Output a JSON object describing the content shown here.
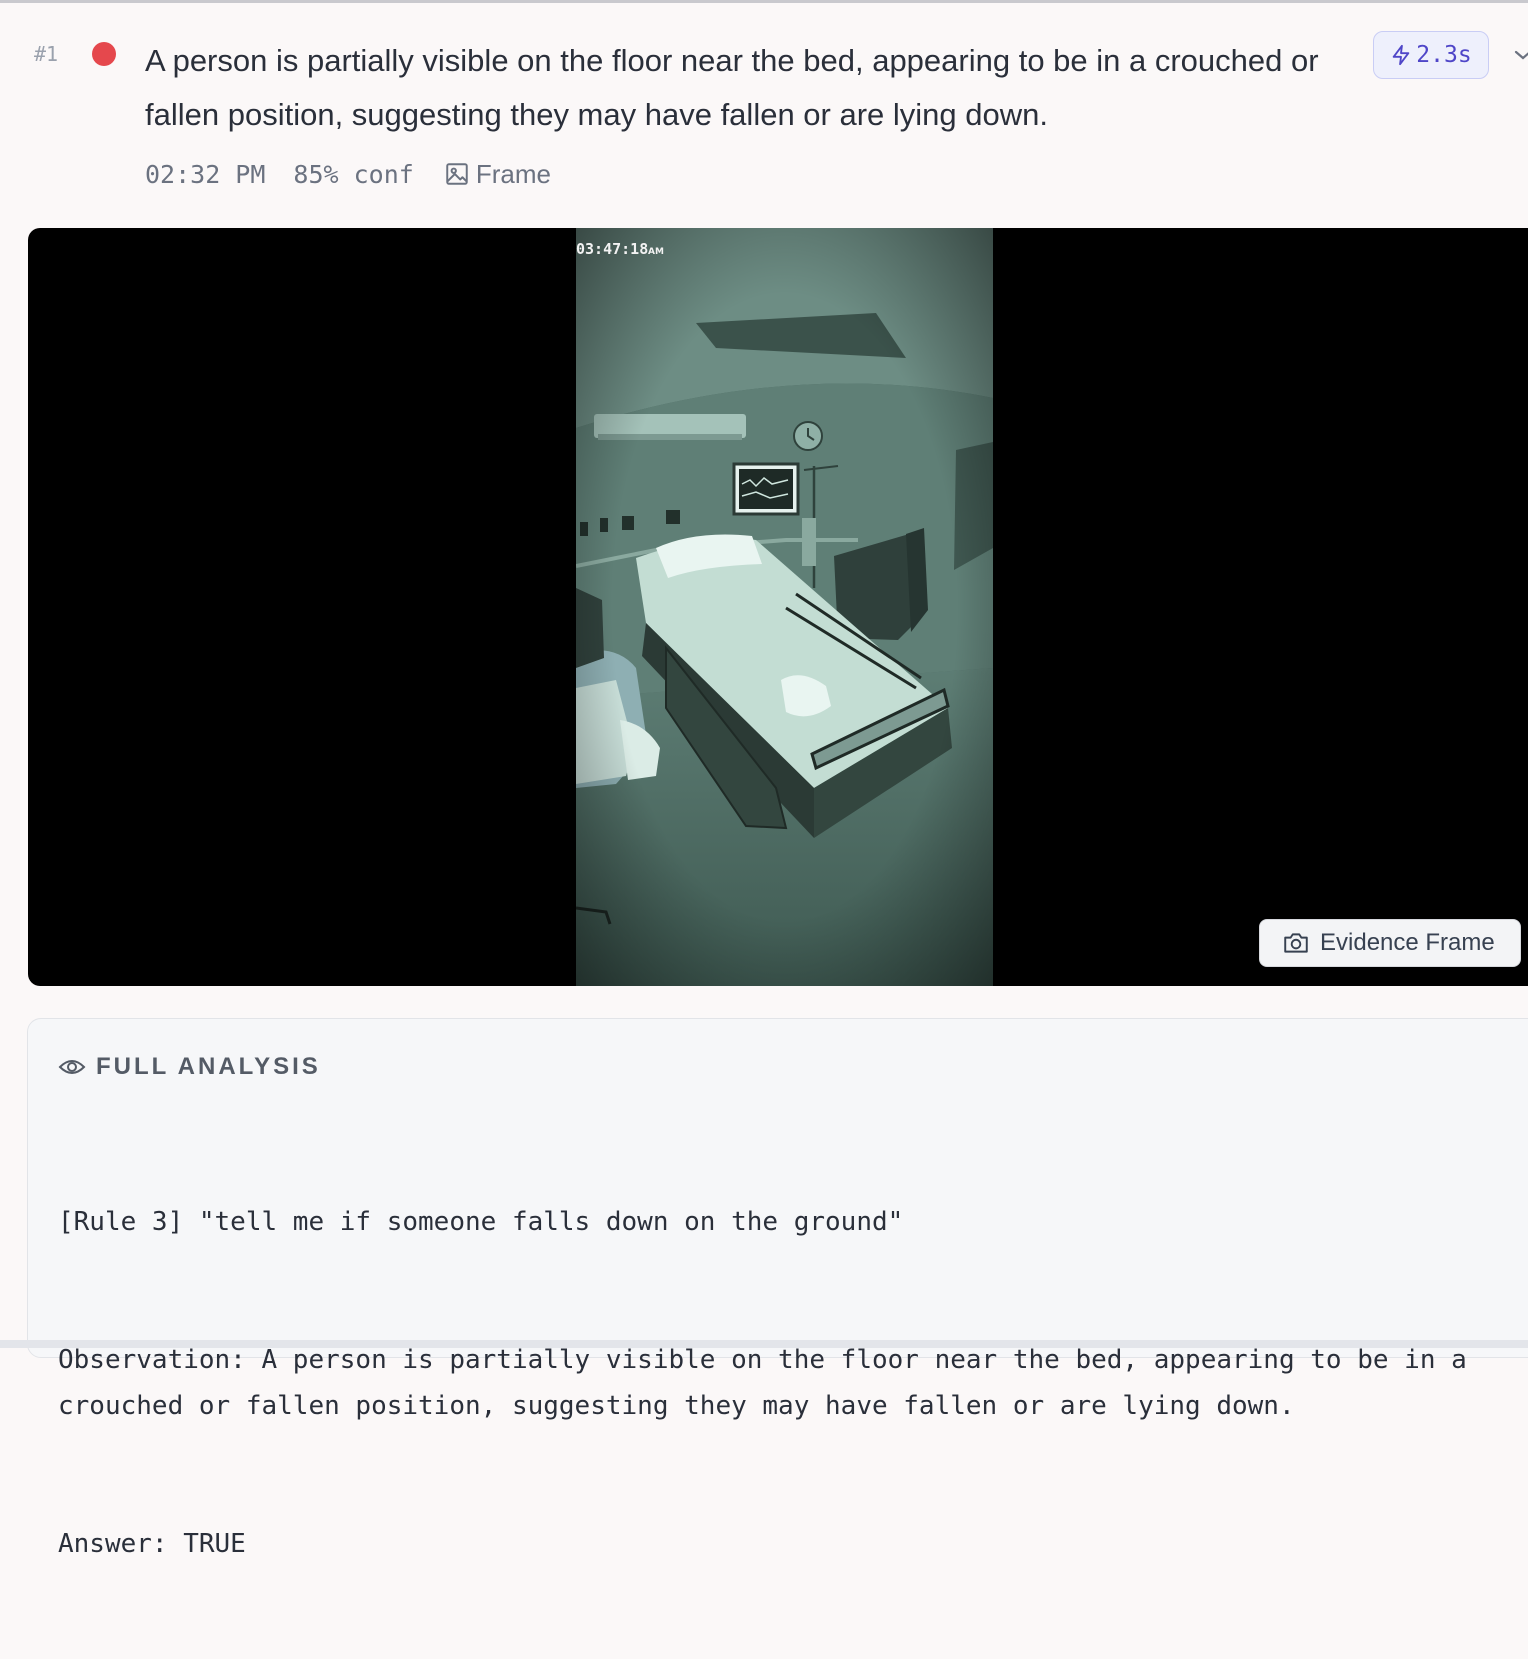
{
  "event": {
    "index": "#1",
    "severity_color": "#e5484d",
    "summary": "A person is partially visible on the floor near the bed, appearing to be in a crouched or fallen position, suggesting they may have fallen or are lying down.",
    "latency": "2.3s",
    "time": "02:32 PM",
    "confidence": "85% conf",
    "frame_link": "Frame"
  },
  "viewer": {
    "camera_timestamp": "03:47:18",
    "camera_timestamp_suffix": "AM",
    "evidence_button": "Evidence Frame"
  },
  "analysis": {
    "title": "FULL ANALYSIS",
    "rule_line": "[Rule 3] \"tell me if someone falls down on the ground\"",
    "observation": "Observation: A person is partially visible on the floor near the bed, appearing to be in a crouched or fallen position, suggesting they may have fallen or are lying down.",
    "answer": "Answer: TRUE"
  },
  "icons": {
    "latency": "lightning-icon",
    "expand": "chevron-down-icon",
    "frame": "image-icon",
    "evidence": "camera-icon",
    "analysis": "eye-icon"
  }
}
